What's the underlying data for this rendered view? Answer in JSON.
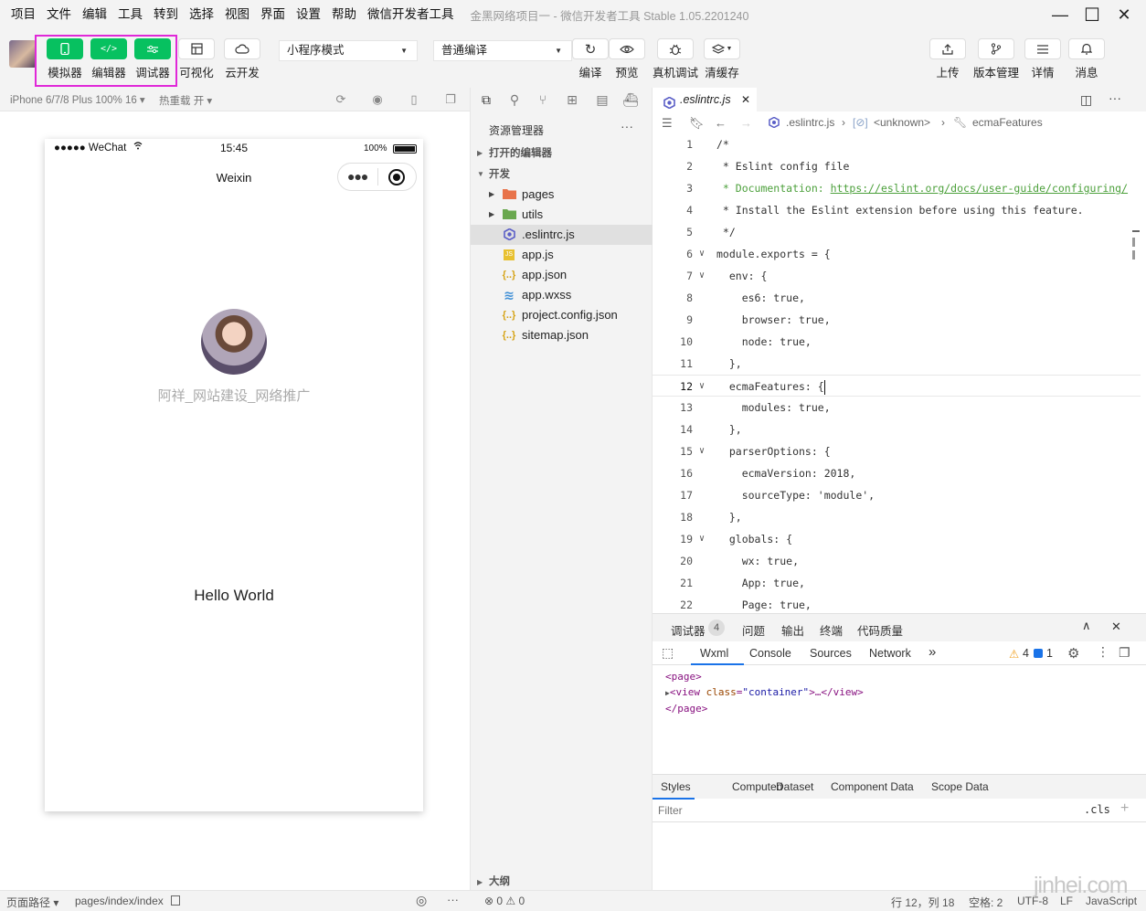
{
  "menubar": {
    "items": [
      "项目",
      "文件",
      "编辑",
      "工具",
      "转到",
      "选择",
      "视图",
      "界面",
      "设置",
      "帮助",
      "微信开发者工具"
    ],
    "window_title": "金黑网络项目一 - 微信开发者工具 Stable 1.05.2201240",
    "minimize": "—",
    "maximize": "☐",
    "close": "✕"
  },
  "toolbar": {
    "simulator_label": "模拟器",
    "editor_label": "编辑器",
    "debugger_label": "调试器",
    "visual_label": "可视化",
    "cloud_label": "云开发",
    "mode_select": "小程序模式",
    "compile_select": "普通编译",
    "compile_label": "编译",
    "preview_label": "预览",
    "device_debug_label": "真机调试",
    "clear_cache_label": "清缓存",
    "upload_label": "上传",
    "version_label": "版本管理",
    "details_label": "详情",
    "messages_label": "消息",
    "accent_color": "#07c160",
    "highlight_color": "#e028d8"
  },
  "simulator": {
    "device": "iPhone 6/7/8 Plus 100% 16 ▾",
    "hot_reload": "热重载 开 ▾",
    "status_signal": "●●●●● WeChat",
    "status_time": "15:45",
    "status_battery": "100%",
    "nav_title": "Weixin",
    "nickname": "阿祥_网站建设_网络推广",
    "hello_text": "Hello World"
  },
  "statusbar": {
    "page_path_label": "页面路径 ▾",
    "page_path": "pages/index/index",
    "problems": "⊗ 0 ⚠ 0",
    "cursor": "行 12，列 18",
    "spaces": "空格: 2",
    "encoding": "UTF-8",
    "eol": "LF",
    "language": "JavaScript"
  },
  "explorer": {
    "title": "资源管理器",
    "more": "···",
    "open_editors": "打开的编辑器",
    "dev_section": "开发",
    "outline_section": "大纲",
    "files": [
      {
        "name": "pages",
        "type": "folder",
        "icon": "folder-icon",
        "color": "#e8734a"
      },
      {
        "name": "utils",
        "type": "folder",
        "icon": "folder-icon",
        "color": "#6aa84f"
      },
      {
        "name": ".eslintrc.js",
        "type": "file",
        "icon": "eslint-icon",
        "color": "#5b5fc7"
      },
      {
        "name": "app.js",
        "type": "file",
        "icon": "js-icon",
        "color": "#e8c130"
      },
      {
        "name": "app.json",
        "type": "file",
        "icon": "json-icon",
        "color": "#d6a418"
      },
      {
        "name": "app.wxss",
        "type": "file",
        "icon": "css-icon",
        "color": "#3f8fd6"
      },
      {
        "name": "project.config.json",
        "type": "file",
        "icon": "json-icon",
        "color": "#d6a418"
      },
      {
        "name": "sitemap.json",
        "type": "file",
        "icon": "json-icon",
        "color": "#d6a418"
      }
    ]
  },
  "editor": {
    "tab_name": ".eslintrc.js",
    "tab_close": "✕",
    "breadcrumb_file": ".eslintrc.js",
    "breadcrumb_unknown": "<unknown>",
    "breadcrumb_symbol": "ecmaFeatures",
    "lines": [
      {
        "n": "1",
        "text": "/*"
      },
      {
        "n": "2",
        "text": " * Eslint config file"
      },
      {
        "n": "3",
        "text": " * Documentation: ",
        "link": "https://eslint.org/docs/user-guide/configuring/"
      },
      {
        "n": "4",
        "text": " * Install the Eslint extension before using this feature."
      },
      {
        "n": "5",
        "text": " */"
      },
      {
        "n": "6",
        "text": "module.exports = {"
      },
      {
        "n": "7",
        "text": "  env: {"
      },
      {
        "n": "8",
        "text": "    es6: true,"
      },
      {
        "n": "9",
        "text": "    browser: true,"
      },
      {
        "n": "10",
        "text": "    node: true,"
      },
      {
        "n": "11",
        "text": "  },"
      },
      {
        "n": "12",
        "text": "  ecmaFeatures: {"
      },
      {
        "n": "13",
        "text": "    modules: true,"
      },
      {
        "n": "14",
        "text": "  },"
      },
      {
        "n": "15",
        "text": "  parserOptions: {"
      },
      {
        "n": "16",
        "text": "    ecmaVersion: 2018,"
      },
      {
        "n": "17",
        "text": "    sourceType: 'module',"
      },
      {
        "n": "18",
        "text": "  },"
      },
      {
        "n": "19",
        "text": "  globals: {"
      },
      {
        "n": "20",
        "text": "    wx: true,"
      },
      {
        "n": "21",
        "text": "    App: true,"
      },
      {
        "n": "22",
        "text": "    Page: true,"
      }
    ]
  },
  "debugger": {
    "tab_debugger": "调试器",
    "badge": "4",
    "tab_problems": "问题",
    "tab_output": "输出",
    "tab_terminal": "终端",
    "tab_quality": "代码质量",
    "dt_wxml": "Wxml",
    "dt_console": "Console",
    "dt_sources": "Sources",
    "dt_network": "Network",
    "dt_more": "»",
    "warn_count": "4",
    "info_count": "1",
    "wxml_open": "<page>",
    "wxml_view_open": "<view ",
    "wxml_attr": "class",
    "wxml_val": "\"container\"",
    "wxml_view_close": ">…</view>",
    "wxml_close": "</page>",
    "styles_tab": "Styles",
    "computed_tab": "Computed",
    "dataset_tab": "Dataset",
    "component_tab": "Component Data",
    "scope_tab": "Scope Data",
    "filter_placeholder": "Filter",
    "cls_label": ".cls",
    "plus_label": "+"
  },
  "watermark": "jinhei.com"
}
